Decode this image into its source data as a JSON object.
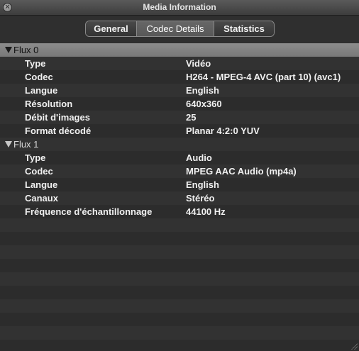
{
  "window": {
    "title": "Media Information"
  },
  "tabs": [
    {
      "label": "General",
      "active": false
    },
    {
      "label": "Codec Details",
      "active": true
    },
    {
      "label": "Statistics",
      "active": false
    }
  ],
  "streams": [
    {
      "label": "Flux 0",
      "expanded": true,
      "rows": [
        {
          "key": "Type",
          "value": "Vidéo"
        },
        {
          "key": "Codec",
          "value": "H264 - MPEG-4 AVC (part 10) (avc1)"
        },
        {
          "key": "Langue",
          "value": "English"
        },
        {
          "key": "Résolution",
          "value": "640x360"
        },
        {
          "key": "Débit d'images",
          "value": "25"
        },
        {
          "key": "Format décodé",
          "value": "Planar 4:2:0 YUV"
        }
      ]
    },
    {
      "label": "Flux 1",
      "expanded": true,
      "rows": [
        {
          "key": "Type",
          "value": "Audio"
        },
        {
          "key": "Codec",
          "value": "MPEG AAC Audio (mp4a)"
        },
        {
          "key": "Langue",
          "value": "English"
        },
        {
          "key": "Canaux",
          "value": "Stéréo"
        },
        {
          "key": "Fréquence d'échantillonnage",
          "value": "44100 Hz"
        }
      ]
    }
  ],
  "colors": {
    "background": "#2c2c2c",
    "selected_row": "#8d8d8d",
    "text": "#f0f0f0"
  }
}
